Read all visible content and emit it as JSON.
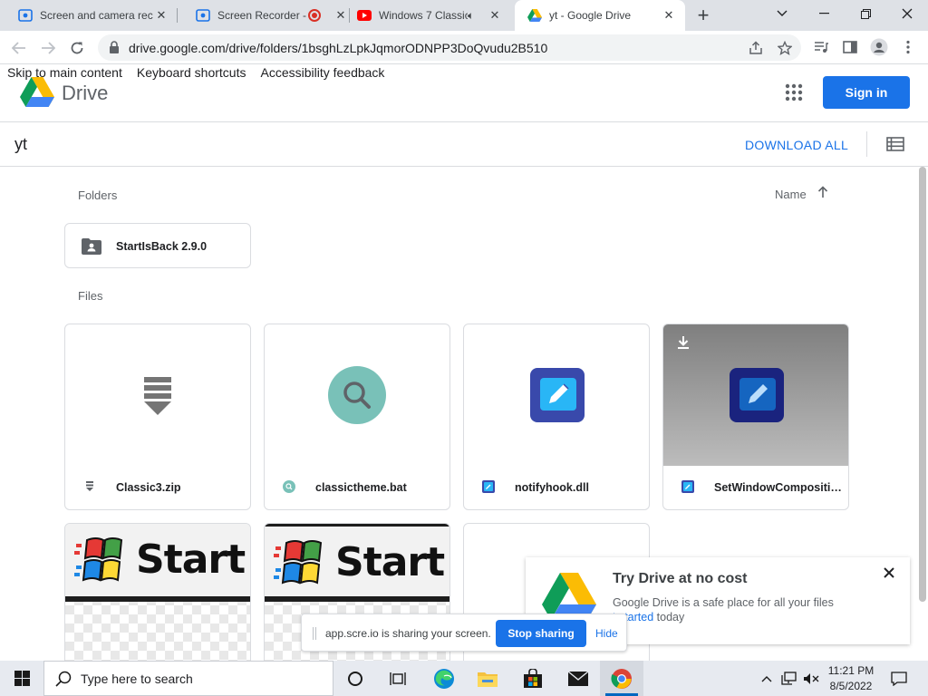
{
  "browser": {
    "tabs": [
      {
        "title": "Screen and camera rec",
        "icon": "screencast-icon",
        "active": false
      },
      {
        "title": "Screen Recorder -",
        "icon": "screencast-icon",
        "active": false,
        "recording": true
      },
      {
        "title": "Windows 7 Classic",
        "icon": "youtube-icon",
        "active": false,
        "audio": true
      },
      {
        "title": "yt - Google Drive",
        "icon": "google-drive-icon",
        "active": true
      }
    ],
    "url": "drive.google.com/drive/folders/1bsghLzLpkJqmorODNPP3DoQvudu2B510"
  },
  "drive": {
    "skip_links": [
      "Skip to main content",
      "Keyboard shortcuts",
      "Accessibility feedback"
    ],
    "app_name": "Drive",
    "sign_in_label": "Sign in",
    "folder_title": "yt",
    "download_all_label": "DOWNLOAD ALL",
    "folders_label": "Folders",
    "sort_label": "Name",
    "files_label": "Files",
    "folders": [
      {
        "name": "StartIsBack 2.9.0",
        "icon": "shared-folder-icon"
      }
    ],
    "files": [
      {
        "name": "Classic3.zip",
        "icon": "zip-icon"
      },
      {
        "name": "classictheme.bat",
        "icon": "search-icon"
      },
      {
        "name": "notifyhook.dll",
        "icon": "edit-icon"
      },
      {
        "name": "SetWindowCompositi…",
        "icon": "edit-icon"
      }
    ],
    "image_previews": [
      {
        "text": "Start",
        "icon": "windows-flag-icon"
      },
      {
        "text": "Start",
        "icon": "windows-flag-icon"
      }
    ]
  },
  "promo": {
    "title": "Try Drive at no cost",
    "line1": "Google Drive is a safe place for all your files",
    "line2_link": "t started",
    "line2_rest": " today"
  },
  "sharing": {
    "message": "app.scre.io is sharing your screen.",
    "stop_label": "Stop sharing",
    "hide_label": "Hide"
  },
  "taskbar": {
    "search_placeholder": "Type here to search",
    "time": "11:21 PM",
    "date": "8/5/2022"
  },
  "colors": {
    "accent": "#1a73e8",
    "tabstrip": "#dee1e6",
    "taskbar": "#e7eaf0"
  }
}
